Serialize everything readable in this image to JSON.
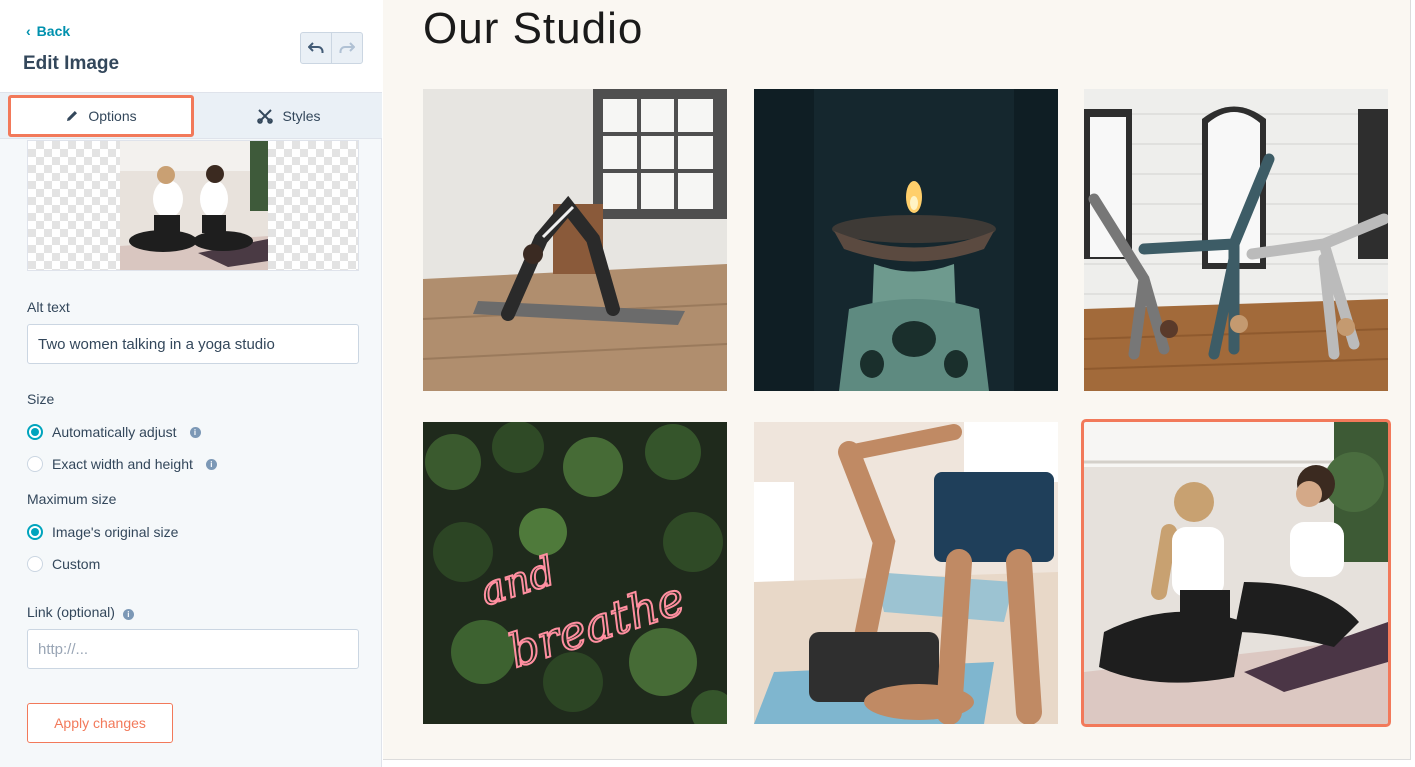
{
  "sidebar": {
    "back_label": "Back",
    "title": "Edit Image",
    "tabs": [
      {
        "label": "Options",
        "active": true
      },
      {
        "label": "Styles",
        "active": false
      }
    ],
    "preview_icon": "image-preview",
    "alt_text": {
      "label": "Alt text",
      "value": "Two women talking in a yoga studio"
    },
    "size": {
      "label": "Size",
      "options": [
        {
          "label": "Automatically adjust",
          "selected": true
        },
        {
          "label": "Exact width and height",
          "selected": false
        }
      ]
    },
    "max_size": {
      "label": "Maximum size",
      "options": [
        {
          "label": "Image's original size",
          "selected": true
        },
        {
          "label": "Custom",
          "selected": false
        }
      ]
    },
    "link": {
      "label": "Link (optional)",
      "value": "",
      "placeholder": "http://..."
    },
    "apply_label": "Apply changes"
  },
  "page": {
    "heading": "Our Studio",
    "gallery": [
      {
        "name": "yoga-pose-studio-photo",
        "selected": false
      },
      {
        "name": "candle-burner-photo",
        "selected": false
      },
      {
        "name": "group-yoga-pose-photo",
        "selected": false
      },
      {
        "name": "and-breathe-neon-photo",
        "selected": false,
        "neon_line_1": "and",
        "neon_line_2": "breathe"
      },
      {
        "name": "assisted-stretch-photo",
        "selected": false
      },
      {
        "name": "women-talking-yoga-photo",
        "selected": true
      }
    ]
  },
  "colors": {
    "accent": "#f2795a",
    "link": "#0091ae",
    "radio": "#00a4bd",
    "panel_bg": "#f5f8fa",
    "page_bg": "#faf7f2"
  }
}
